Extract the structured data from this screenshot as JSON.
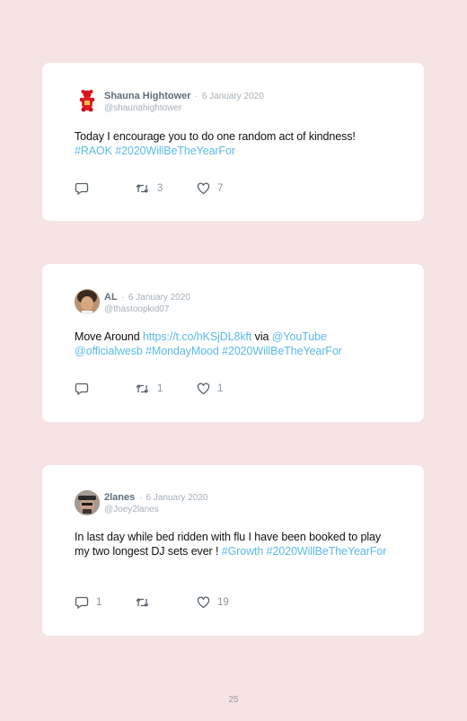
{
  "tweets": [
    {
      "name": "Shauna Hightower",
      "date": "6 January 2020",
      "handle": "@shaunahightower",
      "text_parts": [
        {
          "t": "Today I encourage you to do one random act of kindness! ",
          "link": false
        },
        {
          "t": "#RAOK",
          "link": true
        },
        {
          "t": " ",
          "link": false
        },
        {
          "t": "#2020WillBeTheYearFor",
          "link": true
        }
      ],
      "replies": "",
      "retweets": "3",
      "likes": "7"
    },
    {
      "name": "AL",
      "date": "6 January 2020",
      "handle": "@thastoopkid07",
      "text_parts": [
        {
          "t": "Move Around ",
          "link": false
        },
        {
          "t": "https://t.co/hKSjDL8kft",
          "link": true
        },
        {
          "t": " via ",
          "link": false
        },
        {
          "t": "@YouTube",
          "link": true
        },
        {
          "t": " ",
          "link": false
        },
        {
          "t": "@officialwesb",
          "link": true
        },
        {
          "t": " ",
          "link": false
        },
        {
          "t": "#MondayMood",
          "link": true
        },
        {
          "t": " ",
          "link": false
        },
        {
          "t": "#2020WillBeTheYearFor",
          "link": true
        }
      ],
      "replies": "",
      "retweets": "1",
      "likes": "1"
    },
    {
      "name": "2lanes",
      "date": "6 January 2020",
      "handle": "@Joey2lanes",
      "text_parts": [
        {
          "t": "In last day while bed ridden with flu I have been booked to play my two longest DJ sets ever ! ",
          "link": false
        },
        {
          "t": "#Growth",
          "link": true
        },
        {
          "t": " ",
          "link": false
        },
        {
          "t": "#2020WillBeTheYearFor",
          "link": true
        }
      ],
      "replies": "1",
      "retweets": "",
      "likes": "19"
    }
  ],
  "separator": "·",
  "page_number": "25",
  "colors": {
    "background": "#f6e3e4",
    "link": "#5cbbe6",
    "name": "#5f6f7d",
    "meta": "#a5afb8"
  },
  "icons": {
    "reply": "reply-icon",
    "retweet": "retweet-icon",
    "like": "heart-icon"
  }
}
